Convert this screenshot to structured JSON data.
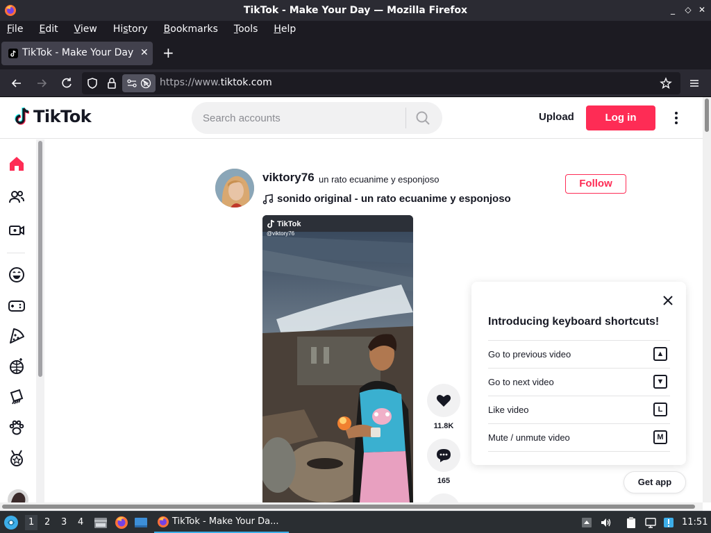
{
  "window": {
    "title": "TikTok - Make Your Day — Mozilla Firefox",
    "minimize": "_",
    "maximize": "◇",
    "close": "✕"
  },
  "menubar": {
    "items": [
      {
        "pre": "",
        "ul": "F",
        "post": "ile"
      },
      {
        "pre": "",
        "ul": "E",
        "post": "dit"
      },
      {
        "pre": "",
        "ul": "V",
        "post": "iew"
      },
      {
        "pre": "Hi",
        "ul": "s",
        "post": "tory"
      },
      {
        "pre": "",
        "ul": "B",
        "post": "ookmarks"
      },
      {
        "pre": "",
        "ul": "T",
        "post": "ools"
      },
      {
        "pre": "",
        "ul": "H",
        "post": "elp"
      }
    ]
  },
  "tabs": [
    {
      "label": "TikTok - Make Your Day",
      "close": "✕"
    }
  ],
  "newtab": "+",
  "navbar": {
    "url_prefix": "https://www.",
    "url_domain": "tiktok.com"
  },
  "tiktok": {
    "logo_text": "TikTok",
    "search_placeholder": "Search accounts",
    "upload_label": "Upload",
    "login_label": "Log in",
    "post": {
      "username": "viktory76",
      "nickname": "un rato ecuanime y esponjoso",
      "music": "sonido original - un rato ecuanime y esponjoso",
      "follow_label": "Follow",
      "watermark_brand": "TikTok",
      "watermark_handle": "@viktory76",
      "likes": "11.8K",
      "comments": "165"
    },
    "shortcuts": {
      "title": "Introducing keyboard shortcuts!",
      "rows": [
        {
          "label": "Go to previous video",
          "key": "▲"
        },
        {
          "label": "Go to next video",
          "key": "▼"
        },
        {
          "label": "Like video",
          "key": "L"
        },
        {
          "label": "Mute / unmute video",
          "key": "M"
        }
      ]
    },
    "get_app_label": "Get app",
    "accent_color": "#fe2c55"
  },
  "taskbar": {
    "workspaces": [
      "1",
      "2",
      "3",
      "4"
    ],
    "active_workspace": "1",
    "task_label": "TikTok - Make Your Da...",
    "clock": "11:51"
  }
}
